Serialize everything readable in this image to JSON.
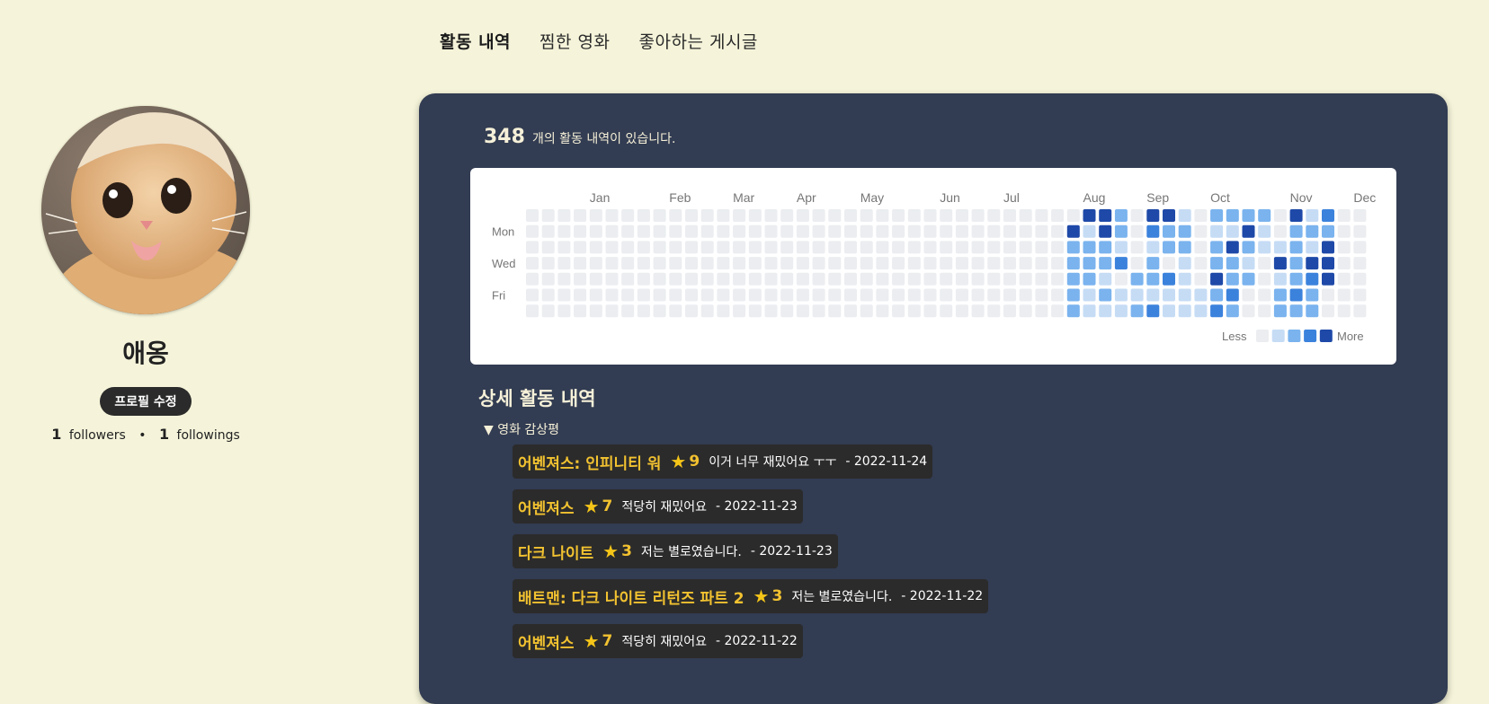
{
  "nav": {
    "tabs": [
      {
        "label": "활동 내역",
        "active": true
      },
      {
        "label": "찜한 영화",
        "active": false
      },
      {
        "label": "좋아하는 게시글",
        "active": false
      }
    ]
  },
  "profile": {
    "username": "애옹",
    "edit_label": "프로필 수정",
    "followers_count": "1",
    "followers_label": "followers",
    "separator": "•",
    "followings_count": "1",
    "followings_label": "followings"
  },
  "activity": {
    "count": "348",
    "count_suffix": "개의 활동 내역이 있습니다.",
    "months": [
      "Jan",
      "Feb",
      "Mar",
      "Apr",
      "May",
      "Jun",
      "Jul",
      "Aug",
      "Sep",
      "Oct",
      "Nov",
      "Dec"
    ],
    "weekdays": [
      "Mon",
      "Wed",
      "Fri"
    ],
    "legend_less": "Less",
    "legend_more": "More",
    "colors": [
      "#ebedf0",
      "#c6dcf5",
      "#7ab3ee",
      "#3b82dc",
      "#1e49a8"
    ],
    "heatmap_levels": [
      [
        0,
        0,
        0,
        0,
        0,
        0,
        0
      ],
      [
        0,
        0,
        0,
        0,
        0,
        0,
        0
      ],
      [
        0,
        0,
        0,
        0,
        0,
        0,
        0
      ],
      [
        0,
        0,
        0,
        0,
        0,
        0,
        0
      ],
      [
        0,
        0,
        0,
        0,
        0,
        0,
        0
      ],
      [
        0,
        0,
        0,
        0,
        0,
        0,
        0
      ],
      [
        0,
        0,
        0,
        0,
        0,
        0,
        0
      ],
      [
        0,
        0,
        0,
        0,
        0,
        0,
        0
      ],
      [
        0,
        0,
        0,
        0,
        0,
        0,
        0
      ],
      [
        0,
        0,
        0,
        0,
        0,
        0,
        0
      ],
      [
        0,
        0,
        0,
        0,
        0,
        0,
        0
      ],
      [
        0,
        0,
        0,
        0,
        0,
        0,
        0
      ],
      [
        0,
        0,
        0,
        0,
        0,
        0,
        0
      ],
      [
        0,
        0,
        0,
        0,
        0,
        0,
        0
      ],
      [
        0,
        0,
        0,
        0,
        0,
        0,
        0
      ],
      [
        0,
        0,
        0,
        0,
        0,
        0,
        0
      ],
      [
        0,
        0,
        0,
        0,
        0,
        0,
        0
      ],
      [
        0,
        0,
        0,
        0,
        0,
        0,
        0
      ],
      [
        0,
        0,
        0,
        0,
        0,
        0,
        0
      ],
      [
        0,
        0,
        0,
        0,
        0,
        0,
        0
      ],
      [
        0,
        0,
        0,
        0,
        0,
        0,
        0
      ],
      [
        0,
        0,
        0,
        0,
        0,
        0,
        0
      ],
      [
        0,
        0,
        0,
        0,
        0,
        0,
        0
      ],
      [
        0,
        0,
        0,
        0,
        0,
        0,
        0
      ],
      [
        0,
        0,
        0,
        0,
        0,
        0,
        0
      ],
      [
        0,
        0,
        0,
        0,
        0,
        0,
        0
      ],
      [
        0,
        0,
        0,
        0,
        0,
        0,
        0
      ],
      [
        0,
        0,
        0,
        0,
        0,
        0,
        0
      ],
      [
        0,
        0,
        0,
        0,
        0,
        0,
        0
      ],
      [
        0,
        0,
        0,
        0,
        0,
        0,
        0
      ],
      [
        0,
        0,
        0,
        0,
        0,
        0,
        0
      ],
      [
        0,
        0,
        0,
        0,
        0,
        0,
        0
      ],
      [
        0,
        0,
        0,
        0,
        0,
        0,
        0
      ],
      [
        0,
        0,
        0,
        0,
        0,
        0,
        0
      ],
      [
        0,
        4,
        2,
        2,
        2,
        2,
        2
      ],
      [
        4,
        1,
        2,
        2,
        2,
        1,
        1
      ],
      [
        4,
        4,
        2,
        2,
        1,
        2,
        1
      ],
      [
        2,
        2,
        1,
        3,
        0,
        1,
        1
      ],
      [
        0,
        0,
        0,
        0,
        2,
        1,
        2
      ],
      [
        4,
        3,
        1,
        2,
        2,
        1,
        3
      ],
      [
        4,
        2,
        2,
        0,
        3,
        1,
        1
      ],
      [
        1,
        2,
        2,
        1,
        1,
        1,
        1
      ],
      [
        0,
        0,
        0,
        0,
        0,
        1,
        1
      ],
      [
        2,
        1,
        2,
        2,
        4,
        2,
        3
      ],
      [
        2,
        1,
        4,
        2,
        2,
        3,
        2
      ],
      [
        2,
        4,
        2,
        1,
        2,
        0,
        0
      ],
      [
        2,
        1,
        1,
        0,
        0,
        0,
        0
      ],
      [
        0,
        0,
        1,
        4,
        1,
        2,
        2
      ],
      [
        4,
        2,
        2,
        2,
        2,
        3,
        2
      ],
      [
        1,
        2,
        1,
        4,
        3,
        2,
        2
      ],
      [
        3,
        2,
        4,
        4,
        4,
        0,
        0
      ],
      [
        0,
        0,
        0,
        0,
        0,
        0,
        0
      ],
      [
        0,
        0,
        0,
        0,
        0,
        0,
        0
      ]
    ]
  },
  "detail": {
    "title": "상세 활동 내역",
    "group_label": "▼ 영화 감상평",
    "reviews": [
      {
        "title": "어벤져스: 인피니티 워",
        "rating": "9",
        "text": "이거 너무 재밌어요 ㅜㅜ",
        "date": "- 2022-11-24"
      },
      {
        "title": "어벤져스",
        "rating": "7",
        "text": "적당히 재밌어요",
        "date": "- 2022-11-23"
      },
      {
        "title": "다크 나이트",
        "rating": "3",
        "text": "저는 별로였습니다.",
        "date": "- 2022-11-23"
      },
      {
        "title": "배트맨: 다크 나이트 리턴즈 파트 2",
        "rating": "3",
        "text": "저는 별로였습니다.",
        "date": "- 2022-11-22"
      },
      {
        "title": "어벤져스",
        "rating": "7",
        "text": "적당히 재밌어요",
        "date": "- 2022-11-22"
      }
    ]
  }
}
